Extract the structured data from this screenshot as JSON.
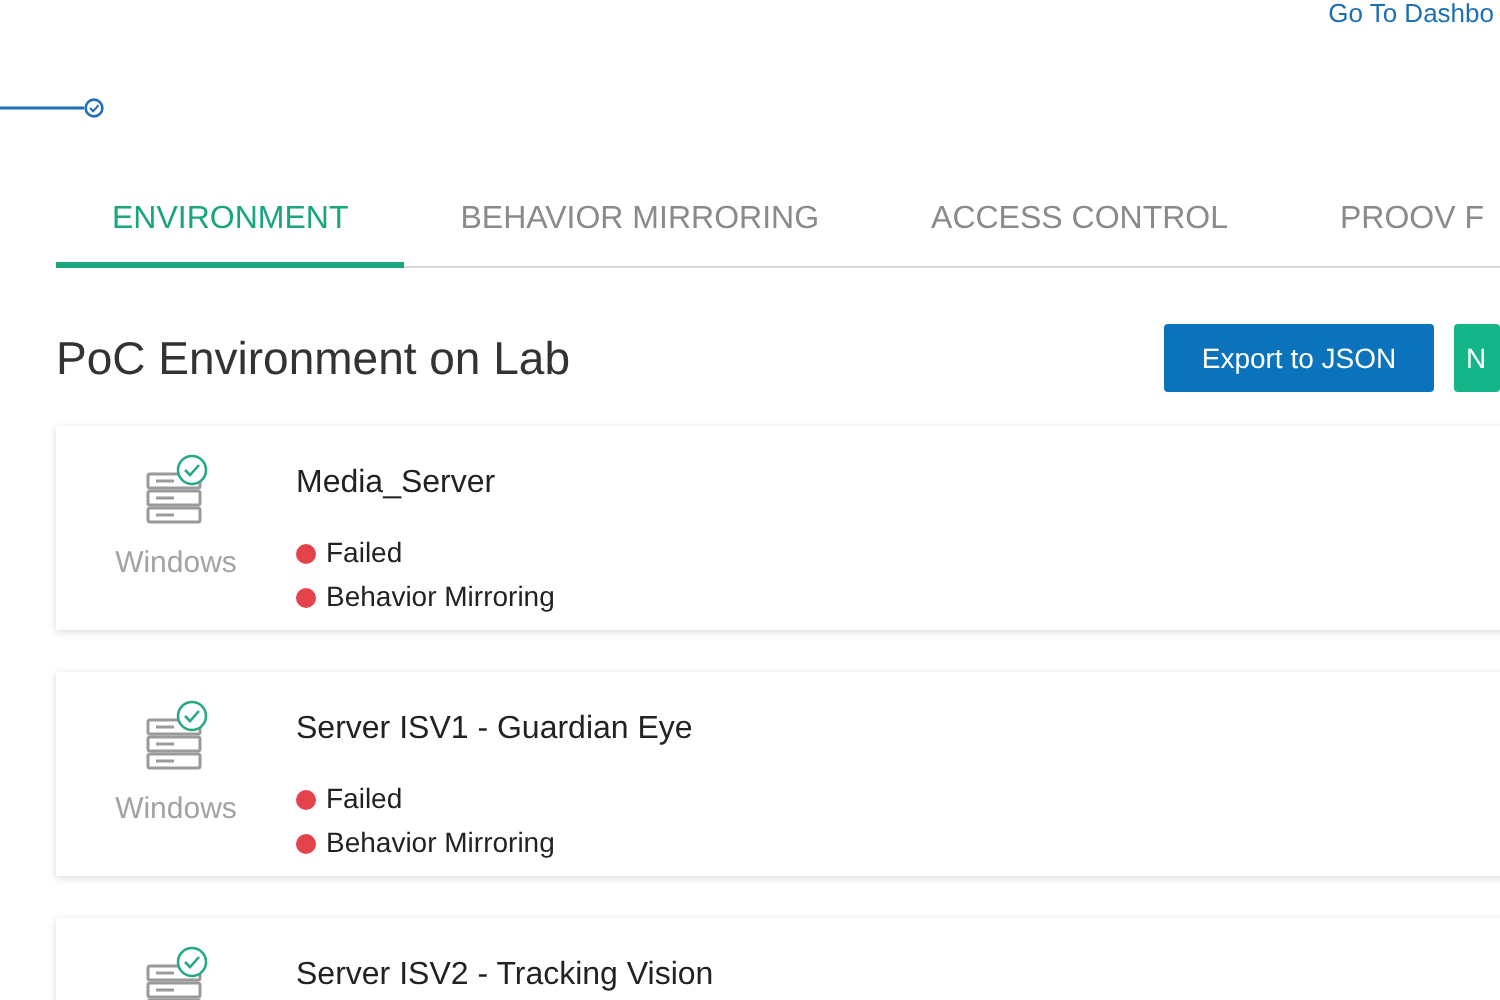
{
  "header": {
    "link": "Go To Dashbo"
  },
  "progress": {
    "completed": true
  },
  "tabs": [
    {
      "label": "ENVIRONMENT",
      "selected": true
    },
    {
      "label": "BEHAVIOR MIRRORING",
      "selected": false
    },
    {
      "label": "ACCESS CONTROL",
      "selected": false
    },
    {
      "label": "PROOV F",
      "selected": false
    }
  ],
  "section": {
    "title": "PoC Environment on Lab",
    "buttons": [
      {
        "label": "Export to JSON",
        "kind": "primary"
      },
      {
        "label": "N",
        "kind": "success"
      }
    ]
  },
  "machines": [
    {
      "name": "Media_Server",
      "os": "Windows",
      "statuses": [
        {
          "label": "Failed",
          "color": "#e5434b"
        },
        {
          "label": "Behavior Mirroring",
          "color": "#e5434b"
        }
      ]
    },
    {
      "name": "Server ISV1 - Guardian Eye",
      "os": "Windows",
      "statuses": [
        {
          "label": "Failed",
          "color": "#e5434b"
        },
        {
          "label": "Behavior Mirroring",
          "color": "#e5434b"
        }
      ]
    },
    {
      "name": "Server ISV2 - Tracking Vision"
    }
  ]
}
